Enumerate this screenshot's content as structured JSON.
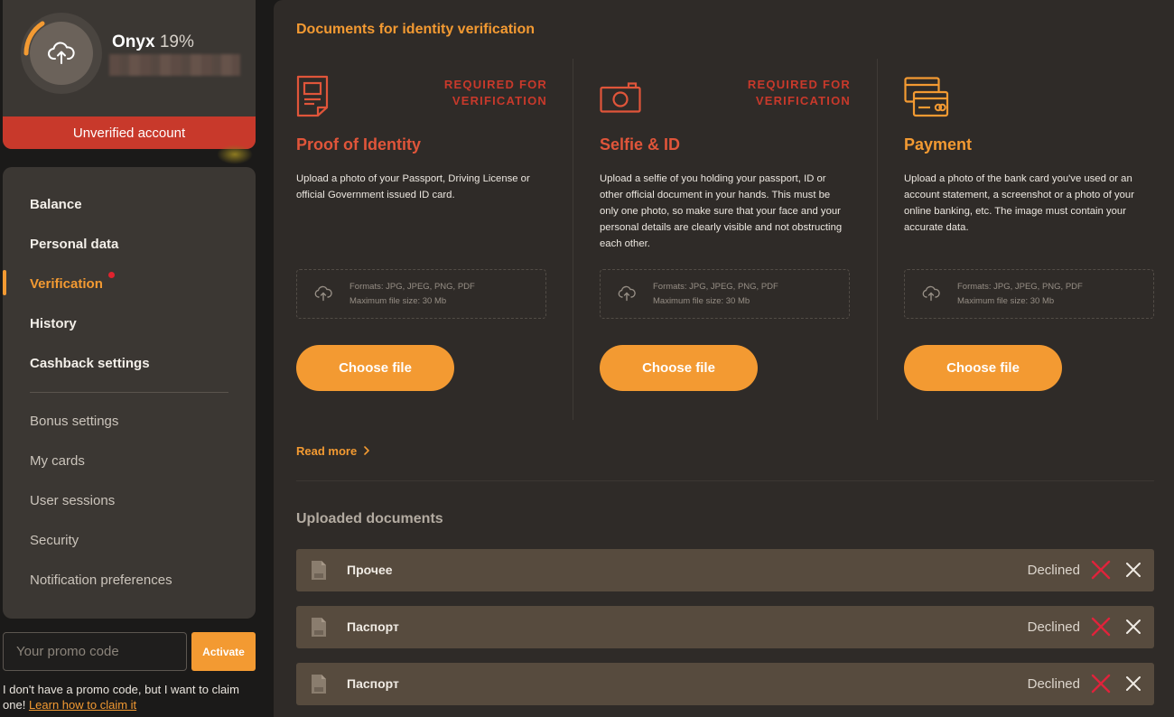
{
  "profile": {
    "name": "Onyx",
    "progress": "19%",
    "progress_value": 0.19,
    "status_banner": "Unverified account"
  },
  "sidebar": {
    "items": [
      {
        "label": "Balance"
      },
      {
        "label": "Personal data"
      },
      {
        "label": "Verification"
      },
      {
        "label": "History"
      },
      {
        "label": "Cashback settings"
      },
      {
        "label": "Bonus settings"
      },
      {
        "label": "My cards"
      },
      {
        "label": "User sessions"
      },
      {
        "label": "Security"
      },
      {
        "label": "Notification preferences"
      }
    ]
  },
  "promo": {
    "placeholder": "Your promo code",
    "activate_label": "Activate",
    "note": "I don't have a promo code, but I want to claim one!",
    "link": "Learn how to claim it"
  },
  "main": {
    "title": "Documents for identity verification",
    "columns": [
      {
        "tag_line1": "REQUIRED FOR",
        "tag_line2": "VERIFICATION",
        "title": "Proof of Identity",
        "description": "Upload a photo of your Passport, Driving License or official Government issued ID card.",
        "formats": "Formats: JPG, JPEG, PNG, PDF",
        "max_size": "Maximum file size: 30 Mb",
        "button": "Choose file",
        "icon": "document-icon"
      },
      {
        "tag_line1": "REQUIRED FOR",
        "tag_line2": "VERIFICATION",
        "title": "Selfie & ID",
        "description": "Upload a selfie of you holding your passport, ID or other official document in your hands. This must be only one photo, so make sure that your face and your personal details are clearly visible and not obstructing each other.",
        "formats": "Formats: JPG, JPEG, PNG, PDF",
        "max_size": "Maximum file size: 30 Mb",
        "button": "Choose file",
        "icon": "camera-icon"
      },
      {
        "title": "Payment",
        "description": "Upload a photo of the bank card you've used or an account statement, a screenshot or a photo of your online banking, etc. The image must contain your accurate data.",
        "formats": "Formats: JPG, JPEG, PNG, PDF",
        "max_size": "Maximum file size: 30 Mb",
        "button": "Choose file",
        "icon": "credit-card-icon"
      }
    ],
    "read_more": "Read more",
    "uploaded_title": "Uploaded documents",
    "uploaded": [
      {
        "name": "Прочее",
        "status": "Declined"
      },
      {
        "name": "Паспорт",
        "status": "Declined"
      },
      {
        "name": "Паспорт",
        "status": "Declined"
      }
    ]
  },
  "colors": {
    "accent": "#f39a32",
    "danger": "#c8392b",
    "title_red": "#e0553a",
    "panel": "#3b3733",
    "main_bg": "#2f2b28"
  }
}
